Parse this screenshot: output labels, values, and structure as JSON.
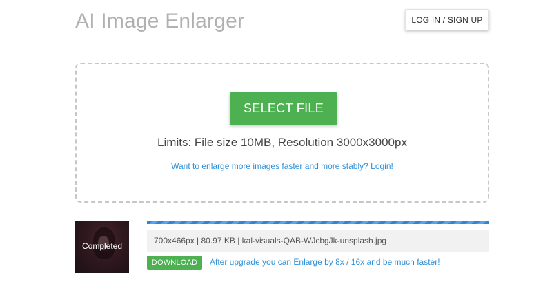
{
  "header": {
    "title": "AI Image Enlarger",
    "login_label": "LOG IN / SIGN UP"
  },
  "upload": {
    "select_label": "SELECT FILE",
    "limits": "Limits: File size 10MB, Resolution 3000x3000px",
    "login_prompt": "Want to enlarge more images faster and more stably? Login!"
  },
  "result": {
    "status": "Completed",
    "progress_percent": 100,
    "file_info": "700x466px | 80.97 KB | kal-visuals-QAB-WJcbgJk-unsplash.jpg",
    "download_label": "DOWNLOAD",
    "upgrade_text": "After upgrade you can Enlarge by 8x / 16x and be much faster!"
  },
  "colors": {
    "accent_green": "#4db151",
    "link_blue": "#2f8fd8",
    "progress_blue": "#2f86d8"
  }
}
